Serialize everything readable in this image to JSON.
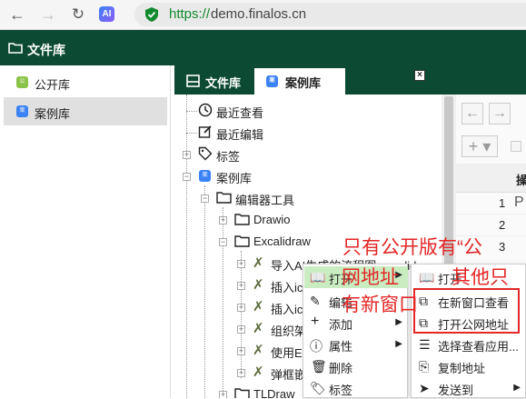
{
  "browser": {
    "url_scheme": "https://",
    "url_host": "demo.finalos.cn",
    "ext_label": "AI"
  },
  "app": {
    "title": "文件库"
  },
  "sidebar": {
    "items": [
      {
        "label": "公开库",
        "icon": "public-library-icon"
      },
      {
        "label": "案例库",
        "icon": "case-library-icon",
        "active": true
      }
    ]
  },
  "tabs": [
    {
      "label": "文件库"
    },
    {
      "label": "案例库",
      "active": true,
      "close": "×"
    }
  ],
  "tree": {
    "recent_viewed": "最近查看",
    "recent_edited": "最近编辑",
    "tags": "标签",
    "case_library": "案例库",
    "editor_tools": "编辑器工具",
    "drawio": "Drawio",
    "excalidraw": "Excalidraw",
    "item1": "导入AI生成的流程图.excalidraw",
    "item2": "插入ic",
    "item3": "插入ic",
    "item4": "组织架",
    "item5": "使用E",
    "item6": "弹框嵌",
    "tldraw": "TLDraw"
  },
  "right_panel": {
    "header": "操",
    "rows": [
      "1",
      "2",
      "3"
    ],
    "row_text": [
      "P",
      "",
      ""
    ]
  },
  "menu1": {
    "items": [
      "打开",
      "编辑",
      "添加",
      "属性",
      "删除",
      "标签"
    ]
  },
  "menu2": {
    "items": [
      "打开",
      "在新窗口查看",
      "打开公网地址",
      "选择查看应用...",
      "复制地址",
      "发送到"
    ]
  },
  "annotation": {
    "line1": "只有公开版有“公",
    "line2a": "网地址",
    "line2b": "其他只",
    "line3": "有新窗口"
  },
  "colors": {
    "header_bg": "#0d4a33",
    "highlight": "#c9ecc0",
    "annotation": "#e32626"
  }
}
